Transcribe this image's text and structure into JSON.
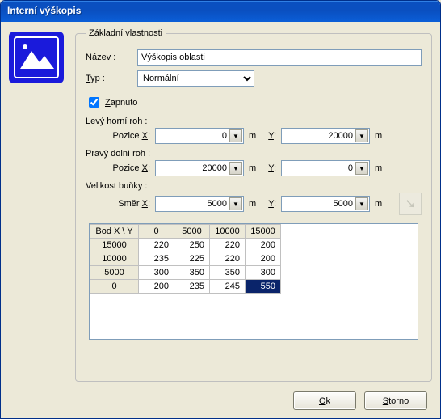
{
  "window": {
    "title": "Interní výškopis"
  },
  "group": {
    "legend": "Základní vlastnosti",
    "name_label": "Název :",
    "name_value": "Výškopis oblasti",
    "type_label": "Typ :",
    "type_value": "Normální",
    "enabled_label": "Zapnuto",
    "enabled_checked": true,
    "topleft_label": "Levý horní roh :",
    "bottomright_label": "Pravý dolní roh :",
    "cellsize_label": "Velikost buňky :",
    "posx_label": "Pozice X:",
    "dirx_label": "Směr X:",
    "y_label": "Y:",
    "unit_m": "m",
    "topleft_x": "0",
    "topleft_y": "20000",
    "bottomright_x": "20000",
    "bottomright_y": "0",
    "cell_x": "5000",
    "cell_y": "5000"
  },
  "grid": {
    "corner": "Bod  X \\ Y",
    "cols": [
      "0",
      "5000",
      "10000",
      "15000"
    ],
    "rows": [
      {
        "head": "15000",
        "cells": [
          "220",
          "250",
          "220",
          "200"
        ]
      },
      {
        "head": "10000",
        "cells": [
          "235",
          "225",
          "220",
          "200"
        ]
      },
      {
        "head": "5000",
        "cells": [
          "300",
          "350",
          "350",
          "300"
        ]
      },
      {
        "head": "0",
        "cells": [
          "200",
          "235",
          "245",
          "550"
        ]
      }
    ],
    "selected": {
      "row": 3,
      "col": 3
    }
  },
  "buttons": {
    "ok": "Ok",
    "cancel": "Storno"
  }
}
